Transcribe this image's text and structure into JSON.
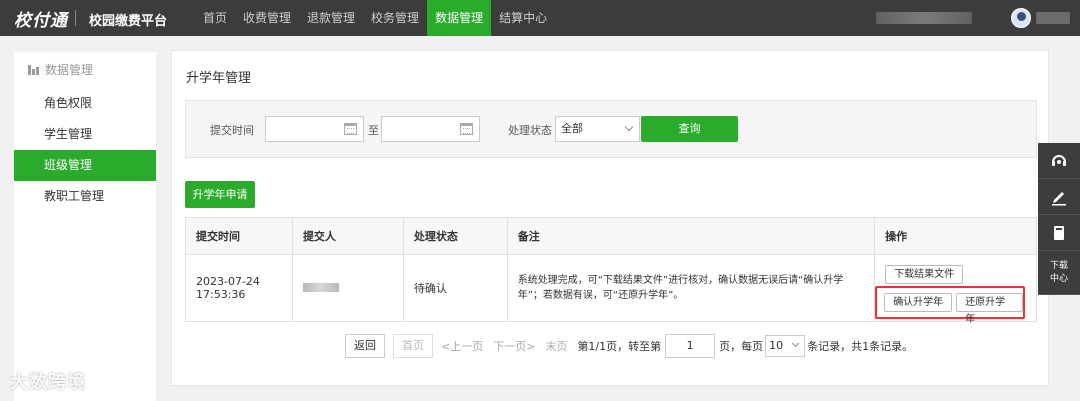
{
  "header": {
    "logo_text": "校付通",
    "platform_title": "校园缴费平台",
    "nav": [
      {
        "label": "首页",
        "active": false
      },
      {
        "label": "收费管理",
        "active": false
      },
      {
        "label": "退款管理",
        "active": false
      },
      {
        "label": "校务管理",
        "active": false
      },
      {
        "label": "数据管理",
        "active": true
      },
      {
        "label": "结算中心",
        "active": false
      }
    ]
  },
  "sidebar": {
    "header": "数据管理",
    "items": [
      {
        "label": "角色权限",
        "active": false
      },
      {
        "label": "学生管理",
        "active": false
      },
      {
        "label": "班级管理",
        "active": true
      },
      {
        "label": "教职工管理",
        "active": false
      }
    ]
  },
  "main": {
    "title": "升学年管理",
    "filter": {
      "submit_time_label": "提交时间",
      "to_label": "至",
      "start_date": "",
      "end_date": "",
      "status_label": "处理状态",
      "status_value": "全部",
      "query_button": "查询"
    },
    "apply_button": "升学年申请",
    "table": {
      "columns": [
        "提交时间",
        "提交人",
        "处理状态",
        "备注",
        "操作"
      ],
      "rows": [
        {
          "submit_time": "2023-07-24 17:53:36",
          "submitter": "",
          "status": "待确认",
          "note": "系统处理完成，可“下载结果文件”进行核对，确认数据无误后请“确认升学年”；若数据有误，可“还原升学年”。",
          "actions": {
            "download": "下载结果文件",
            "confirm": "确认升学年",
            "restore": "还原升学年"
          }
        }
      ]
    },
    "pagination": {
      "back": "返回",
      "first": "首页",
      "prev": "<上一页",
      "next": "下一页>",
      "last": "末页",
      "page_info": "第1/1页，",
      "goto_prefix": "转至第",
      "goto_value": "1",
      "goto_suffix": "页，",
      "per_page_prefix": "每页",
      "per_page_value": "10",
      "per_page_suffix": "条记录，",
      "total": "共1条记录。"
    }
  },
  "float_toolbar": {
    "items": [
      "headset-icon",
      "edit-icon",
      "book-icon"
    ],
    "download_center": "下载中心"
  },
  "watermark": "大数跨境",
  "colors": {
    "accent": "#2bab2b",
    "topbar": "#3c3c3c",
    "pending": "#dd2222",
    "highlight": "#ee3333"
  }
}
